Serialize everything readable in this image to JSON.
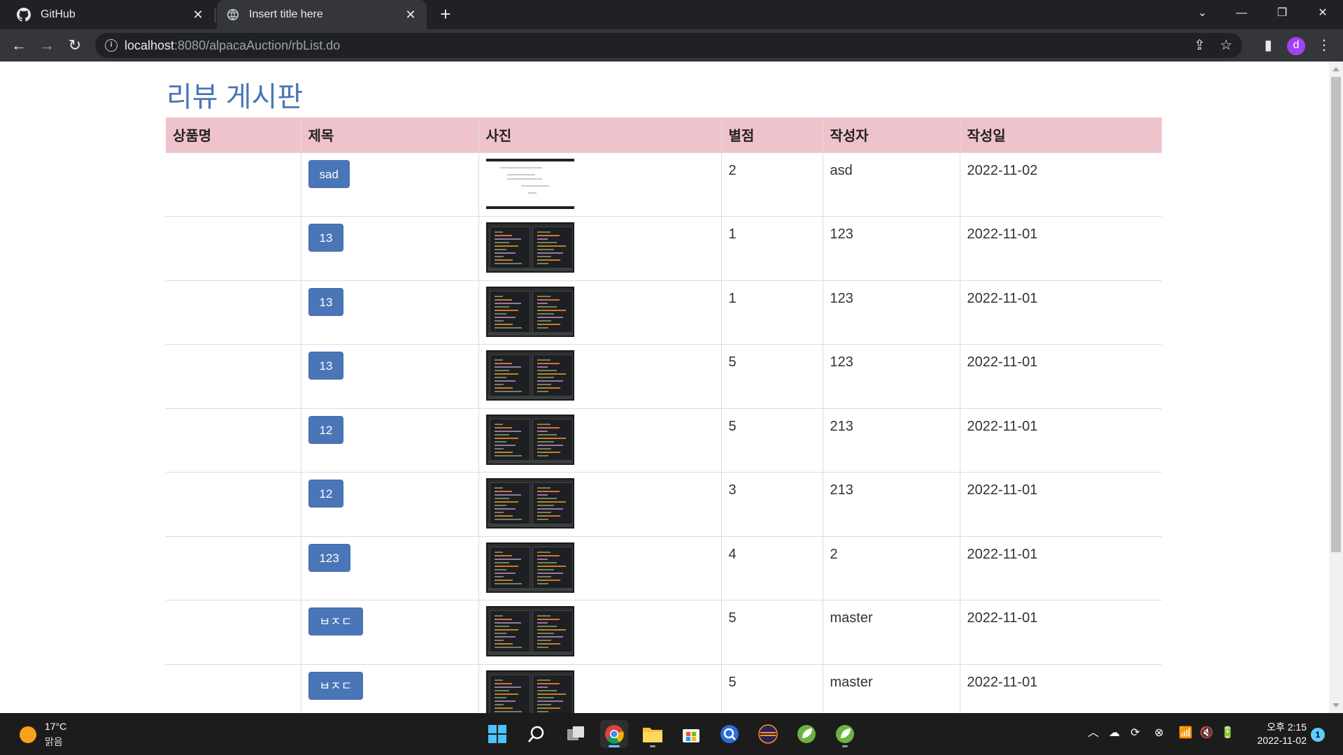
{
  "browser": {
    "tabs": [
      {
        "title": "GitHub",
        "icon": "github-icon"
      },
      {
        "title": "Insert title here",
        "icon": "globe-icon"
      }
    ],
    "url_host": "localhost",
    "url_rest": ":8080/alpacaAuction/rbList.do",
    "profile_initial": "d"
  },
  "page": {
    "title": "리뷰 게시판",
    "columns": [
      "상품명",
      "제목",
      "사진",
      "별점",
      "작성자",
      "작성일"
    ],
    "rows": [
      {
        "product": "",
        "title": "sad",
        "photo": "light",
        "rating": "2",
        "author": "asd",
        "date": "2022-11-02"
      },
      {
        "product": "",
        "title": "13",
        "photo": "dark",
        "rating": "1",
        "author": "123",
        "date": "2022-11-01"
      },
      {
        "product": "",
        "title": "13",
        "photo": "dark",
        "rating": "1",
        "author": "123",
        "date": "2022-11-01"
      },
      {
        "product": "",
        "title": "13",
        "photo": "dark",
        "rating": "5",
        "author": "123",
        "date": "2022-11-01"
      },
      {
        "product": "",
        "title": "12",
        "photo": "dark",
        "rating": "5",
        "author": "213",
        "date": "2022-11-01"
      },
      {
        "product": "",
        "title": "12",
        "photo": "dark",
        "rating": "3",
        "author": "213",
        "date": "2022-11-01"
      },
      {
        "product": "",
        "title": "123",
        "photo": "dark",
        "rating": "4",
        "author": "2",
        "date": "2022-11-01"
      },
      {
        "product": "",
        "title": "ㅂㅈㄷ",
        "photo": "dark",
        "rating": "5",
        "author": "master",
        "date": "2022-11-01"
      },
      {
        "product": "",
        "title": "ㅂㅈㄷ",
        "photo": "dark",
        "rating": "5",
        "author": "master",
        "date": "2022-11-01"
      }
    ]
  },
  "taskbar": {
    "weather_temp": "17°C",
    "weather_desc": "맑음",
    "clock_time": "오후 2:15",
    "clock_date": "2022-11-02",
    "notification_count": "1",
    "apps": [
      "windows-start-icon",
      "search-icon",
      "task-view-icon",
      "chrome-icon",
      "file-explorer-icon",
      "store-icon",
      "app-icon",
      "eclipse-icon",
      "spring-tools-icon",
      "spring-tools-icon"
    ]
  },
  "colors": {
    "title_blue": "#4a76b8",
    "header_pink": "#efc3cb",
    "button_blue": "#4a76b8"
  }
}
